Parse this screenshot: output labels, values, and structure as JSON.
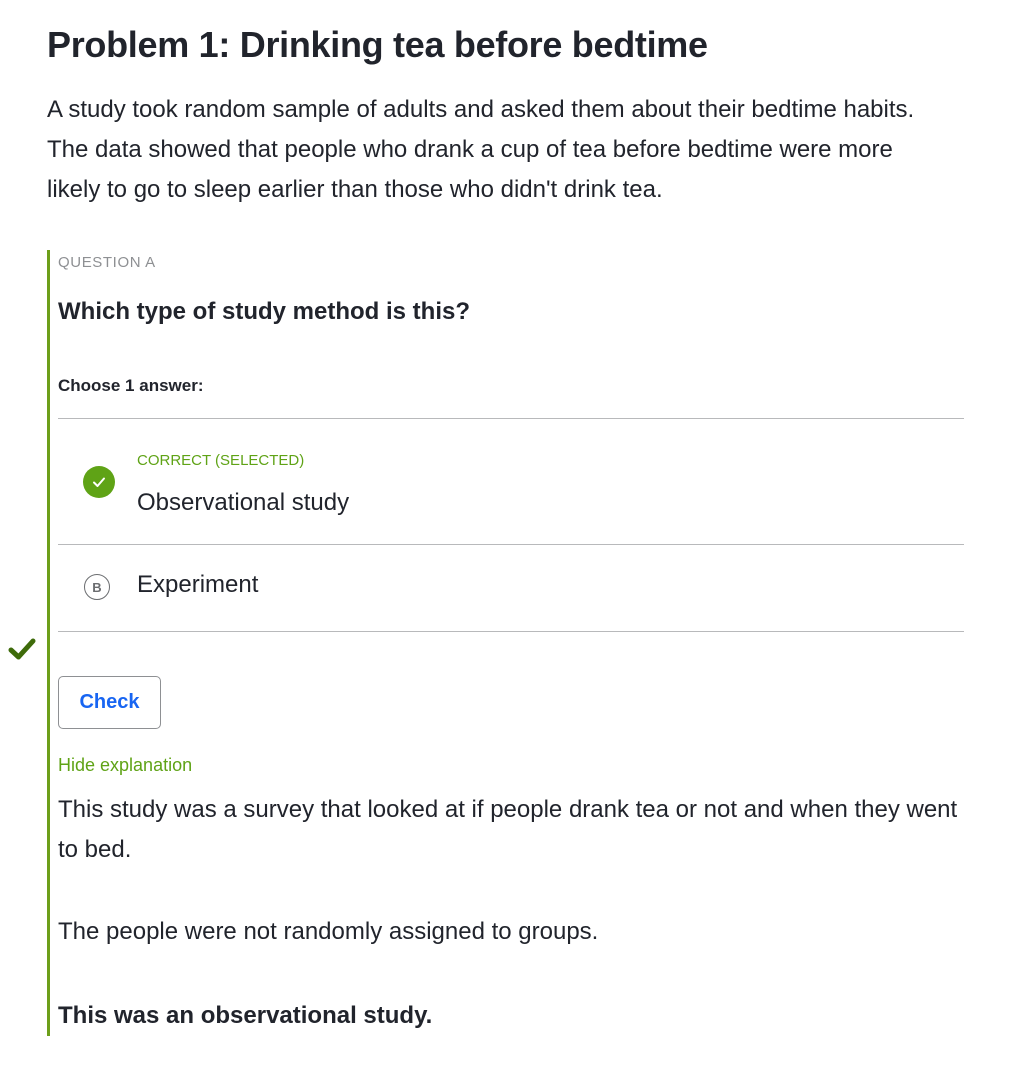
{
  "problem": {
    "title": "Problem 1: Drinking tea before bedtime",
    "intro": "A study took random sample of adults and asked them about their bedtime habits. The data showed that people who drank a cup of tea before bedtime were more likely to go to sleep earlier than those who didn't drink tea."
  },
  "question": {
    "label": "QUESTION A",
    "prompt": "Which type of study method is this?",
    "choose_label": "Choose 1 answer:",
    "choices": [
      {
        "status": "CORRECT (SELECTED)",
        "text": "Observational study",
        "icon": "checkmark-circle-icon",
        "selected": true
      },
      {
        "letter": "B",
        "text": "Experiment",
        "selected": false
      }
    ],
    "check_button": "Check",
    "hide_explanation": "Hide explanation",
    "explanation": [
      "This study was a survey that looked at if people drank tea or not and when they went to bed.",
      "The people were not randomly assigned to groups.",
      "This was an observational study."
    ]
  },
  "colors": {
    "accent_green": "#5fa316",
    "border_green": "#6d9f1a",
    "link_blue": "#1865f2",
    "text": "#21242c"
  }
}
